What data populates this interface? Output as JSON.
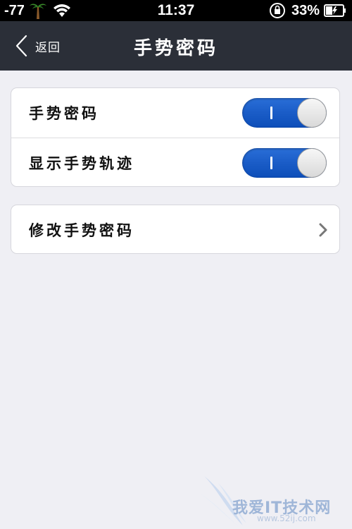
{
  "status_bar": {
    "signal": "-77",
    "time": "11:37",
    "battery_percent": "33%"
  },
  "nav": {
    "back_label": "返回",
    "title": "手势密码"
  },
  "settings": {
    "gesture_password_label": "手势密码",
    "gesture_password_on": true,
    "show_trace_label": "显示手势轨迹",
    "show_trace_on": true,
    "modify_label": "修改手势密码"
  },
  "watermark": {
    "text": "我爱IT技术网",
    "url": "www.52ij.com"
  },
  "colors": {
    "nav_bg": "#2b2f38",
    "toggle_on": "#1a5cc7",
    "page_bg": "#efeff4"
  }
}
